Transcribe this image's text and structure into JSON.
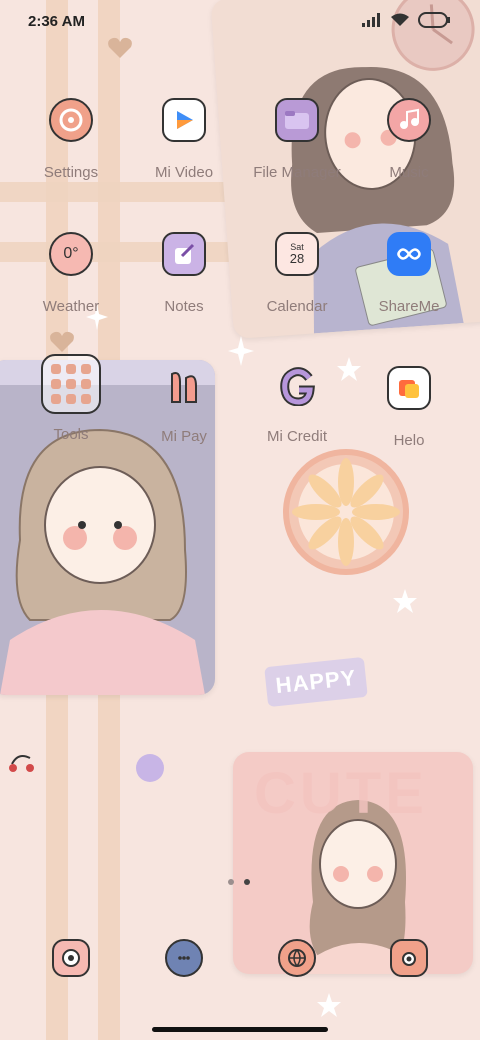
{
  "status_bar": {
    "time": "2:36 AM"
  },
  "apps": [
    {
      "label": "Settings",
      "icon": "settings-icon"
    },
    {
      "label": "Mi Video",
      "icon": "play-icon"
    },
    {
      "label": "File Manager",
      "icon": "folder-icon"
    },
    {
      "label": "Music",
      "icon": "music-icon"
    },
    {
      "label": "Weather",
      "icon": "weather-icon",
      "value": "0°"
    },
    {
      "label": "Notes",
      "icon": "notes-icon"
    },
    {
      "label": "Calendar",
      "icon": "calendar-icon",
      "day": "Sat",
      "date": "28"
    },
    {
      "label": "ShareMe",
      "icon": "shareme-icon"
    },
    {
      "label": "Tools",
      "icon": "folder-grid-icon"
    },
    {
      "label": "Mi Pay",
      "icon": "mipay-icon"
    },
    {
      "label": "Mi Credit",
      "icon": "micredit-icon"
    },
    {
      "label": "Helo",
      "icon": "helo-icon"
    }
  ],
  "dock": [
    {
      "icon": "phone-icon"
    },
    {
      "icon": "messages-icon"
    },
    {
      "icon": "browser-icon"
    },
    {
      "icon": "camera-icon"
    }
  ],
  "wallpaper": {
    "happy_text": "HAPPY",
    "cute_text": "CUTE"
  },
  "colors": {
    "background": "#f7e5df",
    "stripe": "#efd3bf",
    "label": "#8f7c7a",
    "icon_fill": "#f6b9b2",
    "accent_blue": "#2f7cf6"
  },
  "pages": {
    "count": 2,
    "current": 2
  }
}
